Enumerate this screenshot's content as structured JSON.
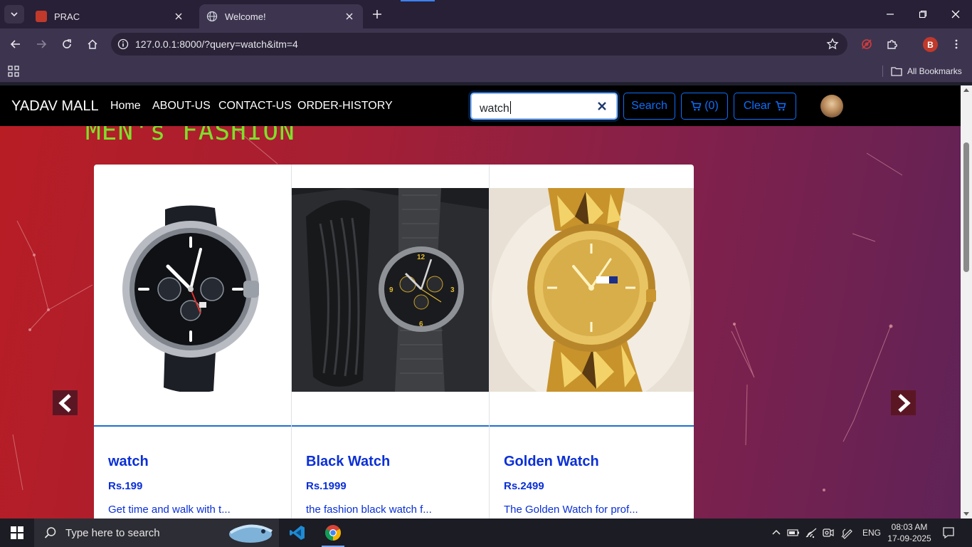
{
  "browser": {
    "tabs": [
      {
        "title": "PRAC",
        "active": false
      },
      {
        "title": "Welcome!",
        "active": true
      }
    ],
    "url": "127.0.0.1:8000/?query=watch&itm=4",
    "profile_initial": "B",
    "bookmarks_label": "All Bookmarks"
  },
  "site": {
    "brand": "YADAV MALL",
    "nav": [
      "Home",
      "ABOUT-US",
      "CONTACT-US",
      "ORDER-HISTORY"
    ],
    "search_value": "watch",
    "search_button": "Search",
    "cart_label": "(0)",
    "clear_label": "Clear",
    "section_title": "MEN's FASHION",
    "accent_color": "#0d6efd",
    "title_color": "#7ee02a"
  },
  "products": [
    {
      "name": "watch",
      "price": "Rs.199",
      "desc": "Get time and walk with t..."
    },
    {
      "name": "Black Watch",
      "price": "Rs.1999",
      "desc": "the fashion black watch f..."
    },
    {
      "name": "Golden Watch",
      "price": "Rs.2499",
      "desc": "The Golden Watch for prof..."
    }
  ],
  "taskbar": {
    "search_placeholder": "Type here to search",
    "language": "ENG",
    "time": "08:03 AM",
    "date": "17-09-2025"
  }
}
